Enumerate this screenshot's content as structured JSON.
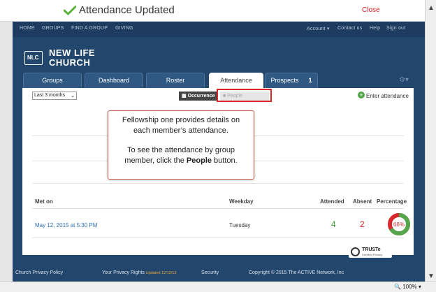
{
  "notification": {
    "title": "Attendance Updated",
    "close_label": "Close",
    "accent": "#5cb23f"
  },
  "topnav": {
    "left": [
      "HOME",
      "GROUPS",
      "FIND A GROUP",
      "GIVING"
    ],
    "right": [
      "Account ▾",
      "Contact us",
      "Help",
      "Sign out"
    ]
  },
  "logo": {
    "mark": "NLC",
    "line1": "NEW LIFE",
    "line2": "CHURCH"
  },
  "tabs": [
    {
      "label": "Groups"
    },
    {
      "label": "Dashboard"
    },
    {
      "label": "Roster"
    },
    {
      "label": "Attendance",
      "active": true
    },
    {
      "label": "Prospects",
      "badge": "1"
    }
  ],
  "filter": {
    "selected": "Last 3 months"
  },
  "toggle": {
    "occurrence_label": "Occurrence",
    "people_label": "People"
  },
  "enter_attendance_label": "Enter attendance",
  "callout": {
    "line1": "Fellowship one provides details on",
    "line2": "each member’s attendance.",
    "line3": "To see the attendance by group",
    "line4_prefix": "member, click the ",
    "line4_bold": "People",
    "line4_suffix": " button."
  },
  "table": {
    "headers": {
      "met_on": "Met on",
      "weekday": "Weekday",
      "attended": "Attended",
      "absent": "Absent",
      "percentage": "Percentage"
    },
    "rows": [
      {
        "met_on": "May 12, 2015 at 5:30 PM",
        "weekday": "Tuesday",
        "attended": "4",
        "absent": "2",
        "percentage_label": "66%",
        "percentage": 66
      }
    ]
  },
  "colors": {
    "attended": "#3a9a3a",
    "absent": "#d8262b",
    "nav": "#23466d"
  },
  "footer": {
    "privacy": "Church Privacy Policy",
    "rights": "Your Privacy Rights",
    "rights_updated": "Updated 12/12/13",
    "security": "Security",
    "copyright": "Copyright © 2015 The ACTIVE Network, Inc",
    "truste_title": "TRUSTe",
    "truste_sub": "Certified Privacy"
  },
  "statusbar": {
    "zoom": "100%"
  }
}
